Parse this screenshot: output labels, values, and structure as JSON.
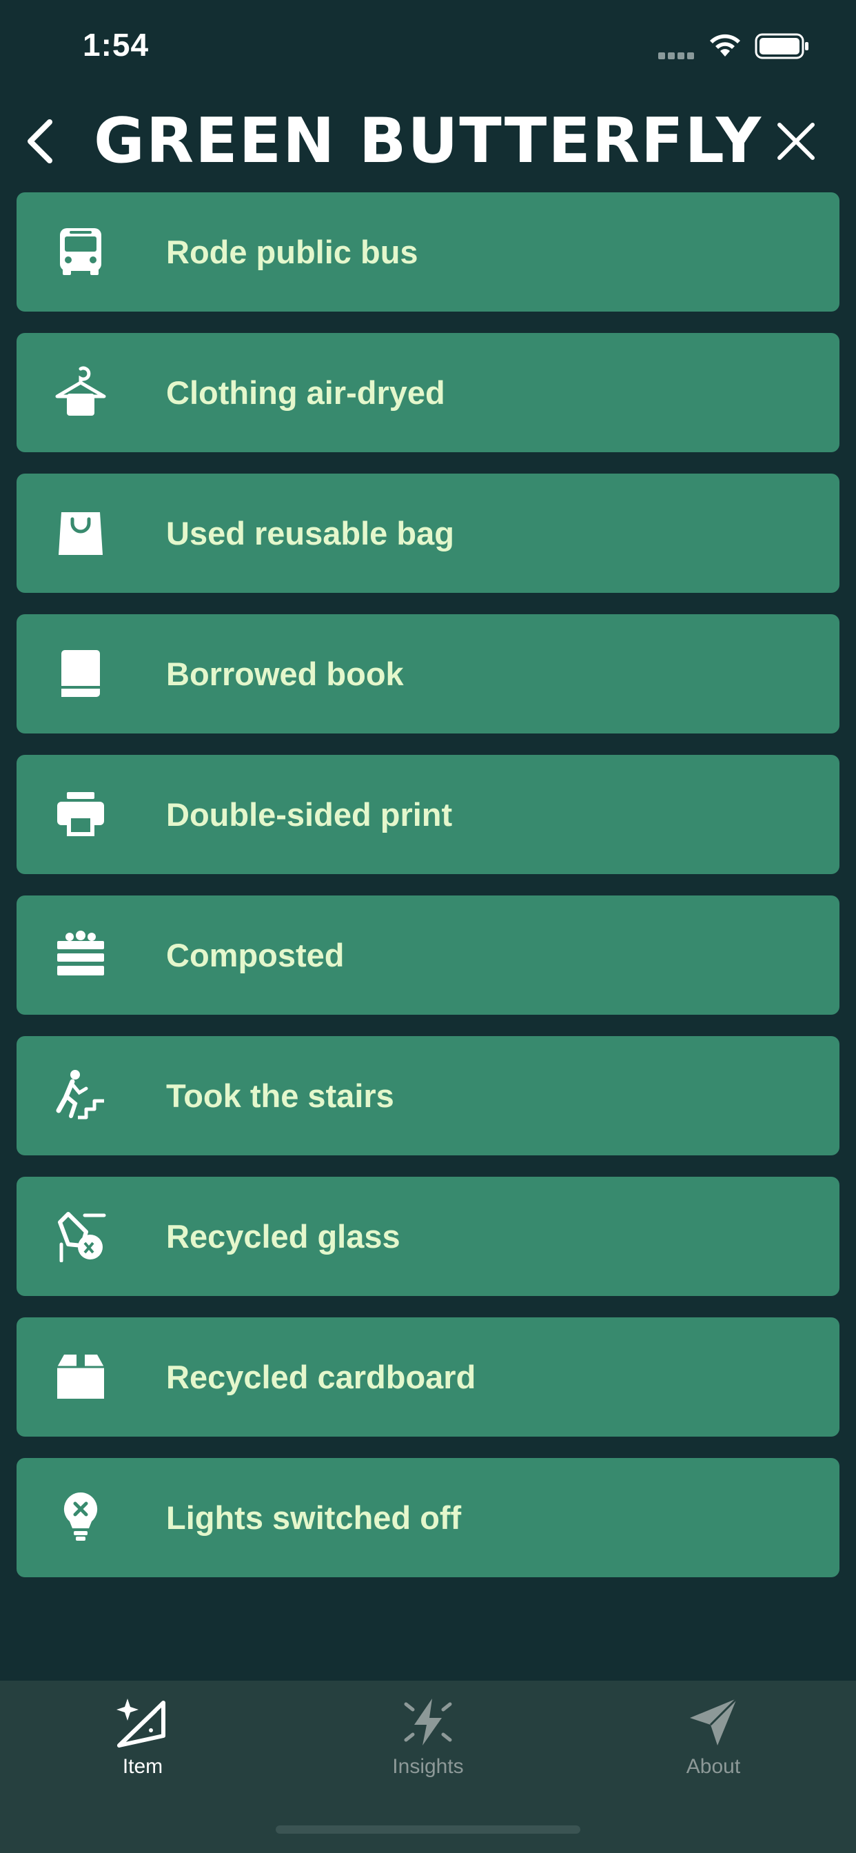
{
  "status_bar": {
    "time": "1:54"
  },
  "header": {
    "title": "Green Butterfly",
    "back_icon": "chevron-left-icon",
    "close_icon": "close-icon"
  },
  "items": [
    {
      "label": "Rode public bus",
      "icon": "bus-icon"
    },
    {
      "label": "Clothing air-dryed",
      "icon": "hanger-icon"
    },
    {
      "label": "Used reusable bag",
      "icon": "shopping-bag-icon"
    },
    {
      "label": "Borrowed book",
      "icon": "book-icon"
    },
    {
      "label": "Double-sided print",
      "icon": "printer-icon"
    },
    {
      "label": "Composted",
      "icon": "compost-bin-icon"
    },
    {
      "label": "Took the stairs",
      "icon": "stairs-icon"
    },
    {
      "label": "Recycled glass",
      "icon": "glass-recycle-icon"
    },
    {
      "label": "Recycled cardboard",
      "icon": "box-icon"
    },
    {
      "label": "Lights switched off",
      "icon": "lightbulb-off-icon"
    }
  ],
  "tabs": [
    {
      "label": "Item",
      "icon": "magic-wand-icon",
      "active": true
    },
    {
      "label": "Insights",
      "icon": "lightning-icon",
      "active": false
    },
    {
      "label": "About",
      "icon": "paper-plane-icon",
      "active": false
    }
  ],
  "colors": {
    "background": "#132e32",
    "item_background": "#388a6e",
    "item_text": "#e4f7cc",
    "tab_bar": "#26403f",
    "tab_active": "#ffffff",
    "tab_inactive": "#8d9998"
  }
}
